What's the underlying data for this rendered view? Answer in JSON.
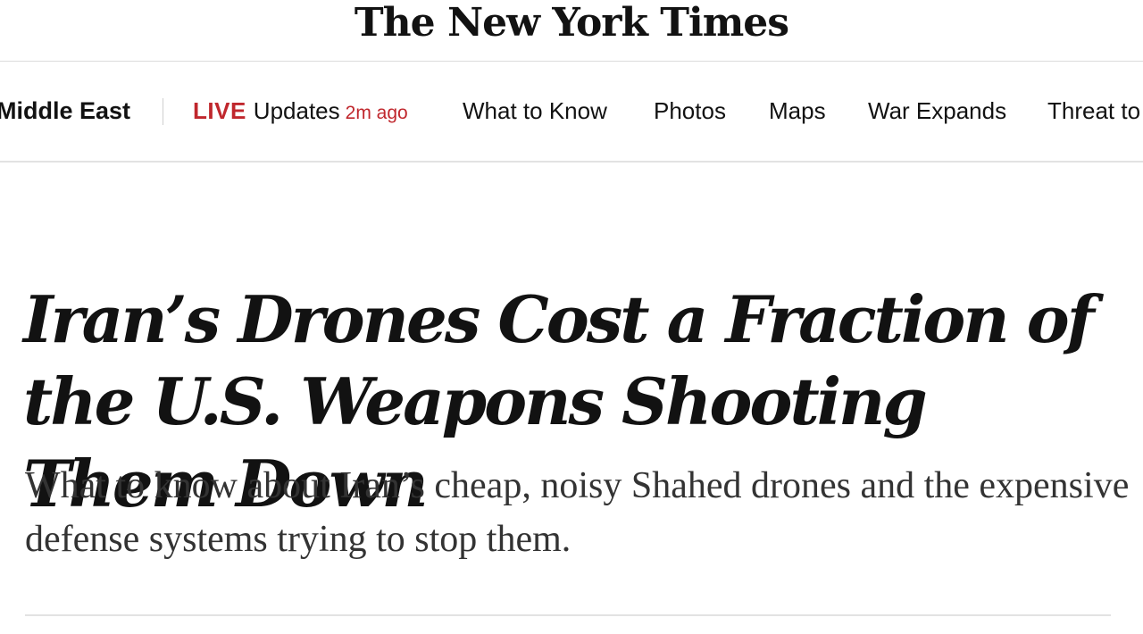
{
  "masthead": {
    "logo_text": "The New York Times"
  },
  "nav": {
    "section_title": "Middle East",
    "live_label": "LIVE",
    "live_text": "Updates",
    "live_time": "2m ago",
    "links": [
      "What to Know",
      "Photos",
      "Maps",
      "War Expands",
      "Threat to"
    ]
  },
  "article": {
    "headline": "Iran’s Drones Cost a Fraction of the U.S. Weapons Shooting Them Down",
    "summary": "What to know about Iran’s cheap, noisy Shahed drones and the expensive defense systems trying to stop them."
  },
  "colors": {
    "live_red": "#c0272d",
    "text": "#121212",
    "summary_text": "#333333",
    "rule": "#e2e2e2"
  }
}
